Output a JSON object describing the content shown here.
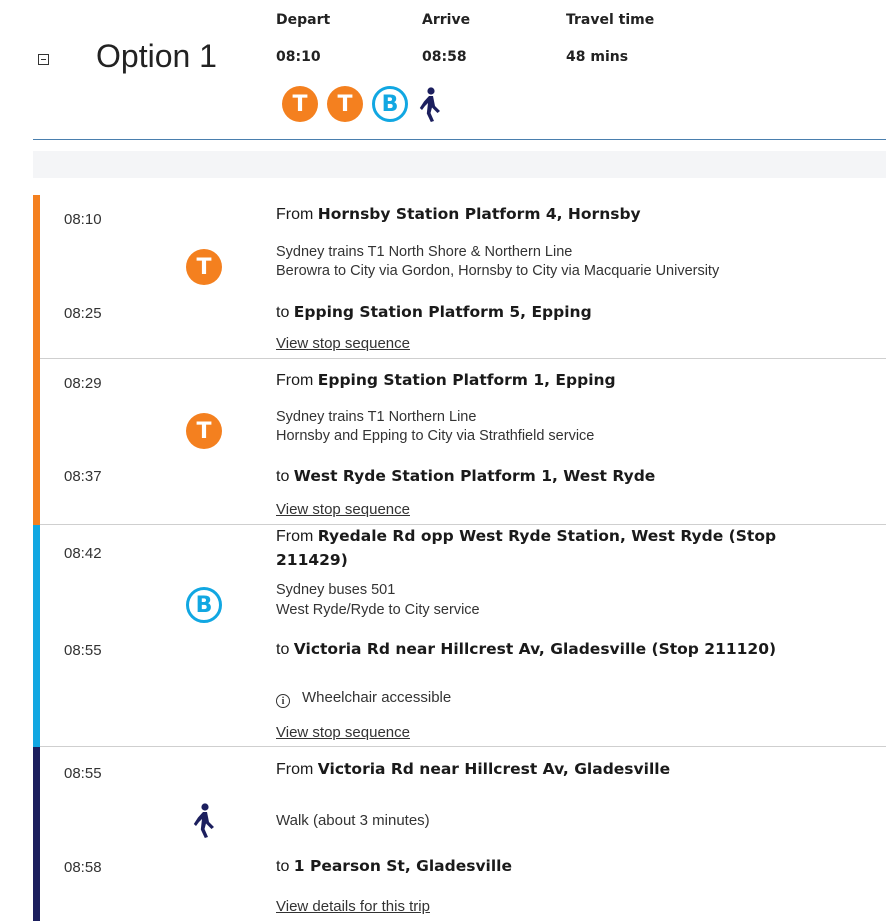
{
  "option": {
    "title": "Option 1",
    "depart_label": "Depart",
    "arrive_label": "Arrive",
    "travel_label": "Travel time",
    "depart": "08:10",
    "arrive": "08:58",
    "travel": "48 mins",
    "modes": [
      {
        "type": "train",
        "glyph": "T"
      },
      {
        "type": "train",
        "glyph": "T"
      },
      {
        "type": "bus",
        "glyph": "B"
      },
      {
        "type": "walk",
        "glyph": ""
      }
    ]
  },
  "colors": {
    "train": "#f4801f",
    "bus": "#11a7e2",
    "walk": "#1c1f5e",
    "header_rule": "#4a7fae"
  },
  "legs": [
    {
      "mode": "train",
      "icon": "train-icon",
      "start_time": "08:10",
      "end_time": "08:25",
      "from_prefix": "From ",
      "from": "Hornsby Station Platform 4, Hornsby",
      "service_line1": "Sydney trains T1 North Shore & Northern Line",
      "service_line2": "Berowra to City via Gordon, Hornsby to City via Macquarie University",
      "to_prefix": "to ",
      "to": "Epping Station Platform 5, Epping",
      "link": "View stop sequence"
    },
    {
      "mode": "train",
      "icon": "train-icon",
      "start_time": "08:29",
      "end_time": "08:37",
      "from_prefix": "From ",
      "from": "Epping Station Platform 1, Epping",
      "service_line1": "Sydney trains T1 Northern Line",
      "service_line2": "Hornsby and Epping to City via Strathfield service",
      "to_prefix": "to ",
      "to": "West Ryde Station Platform 1, West Ryde",
      "link": "View stop sequence"
    },
    {
      "mode": "bus",
      "icon": "bus-icon",
      "start_time": "08:42",
      "end_time": "08:55",
      "from_prefix": "From ",
      "from_line1": "Ryedale Rd opp West Ryde Station, West Ryde (Stop",
      "from_line2": "211429)",
      "service_line1": "Sydney buses 501",
      "service_line2": "West Ryde/Ryde to City service",
      "to_prefix": "to ",
      "to": "Victoria Rd near Hillcrest Av, Gladesville (Stop 211120)",
      "accessibility": "Wheelchair accessible",
      "link": "View stop sequence"
    },
    {
      "mode": "walk",
      "icon": "walk-icon",
      "start_time": "08:55",
      "end_time": "08:58",
      "from_prefix": "From ",
      "from": "Victoria Rd near Hillcrest Av, Gladesville",
      "description": "Walk (about 3 minutes)",
      "to_prefix": "to ",
      "to": "1 Pearson St, Gladesville",
      "link": "View details for this trip"
    }
  ]
}
